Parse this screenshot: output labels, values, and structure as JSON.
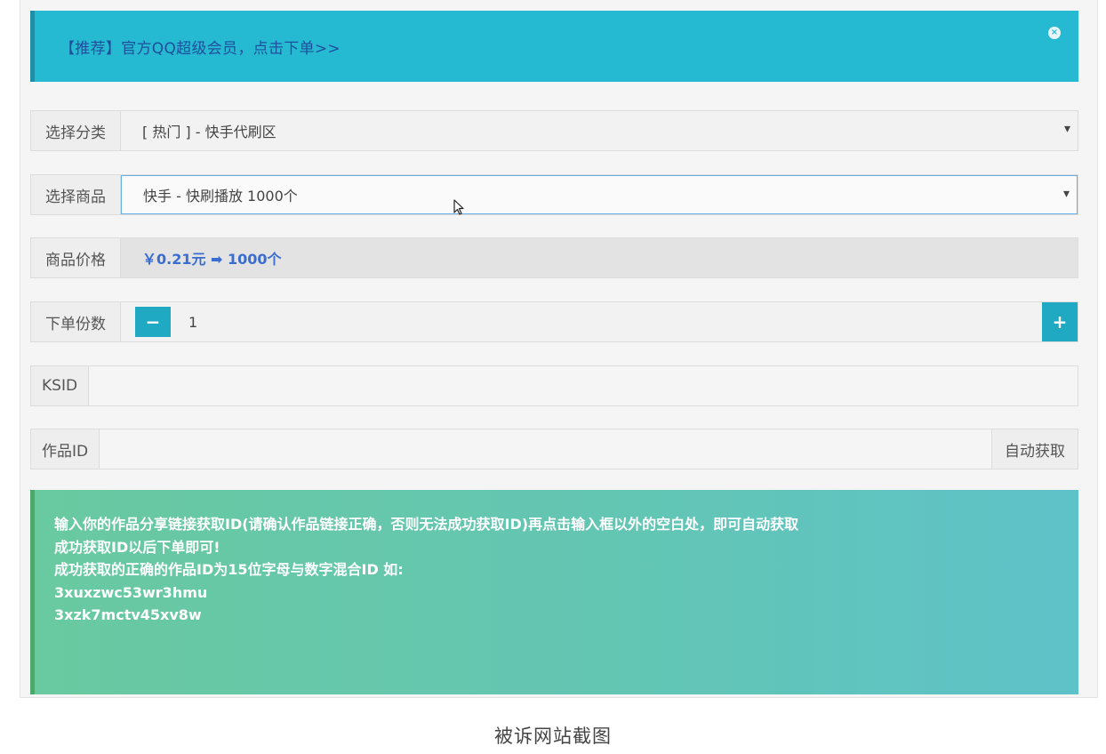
{
  "promo": {
    "text": "【推荐】官方QQ超级会员，点击下单>>",
    "close_glyph": "×"
  },
  "form": {
    "category": {
      "label": "选择分类",
      "value": "[ 热门 ] - 快手代刷区"
    },
    "product": {
      "label": "选择商品",
      "value": "快手 - 快刷播放 1000个"
    },
    "price": {
      "label": "商品价格",
      "value": "￥0.21元 ➡ 1000个"
    },
    "quantity": {
      "label": "下单份数",
      "minus": "−",
      "value": "1",
      "plus": "+"
    },
    "ksid": {
      "label": "KSID",
      "value": ""
    },
    "work_id": {
      "label": "作品ID",
      "value": "",
      "auto_button": "自动获取"
    }
  },
  "info": {
    "lines": [
      "输入你的作品分享链接获取ID(请确认作品链接正确，否则无法成功获取ID)再点击输入框以外的空白处，即可自动获取",
      "成功获取ID以后下单即可!",
      "成功获取的正确的作品ID为15位字母与数字混合ID 如:",
      "3xuxzwc53wr3hmu",
      "3xzk7mctv45xv8w"
    ]
  },
  "caption": "被诉网站截图",
  "colors": {
    "accent": "#26bad2",
    "button": "#1fa9c3",
    "price": "#3b6dcf",
    "info_bg": "#63c6b3"
  },
  "icons": [
    "close-icon",
    "minus-icon",
    "plus-icon",
    "dropdown-arrow-icon",
    "mouse-cursor-icon"
  ]
}
